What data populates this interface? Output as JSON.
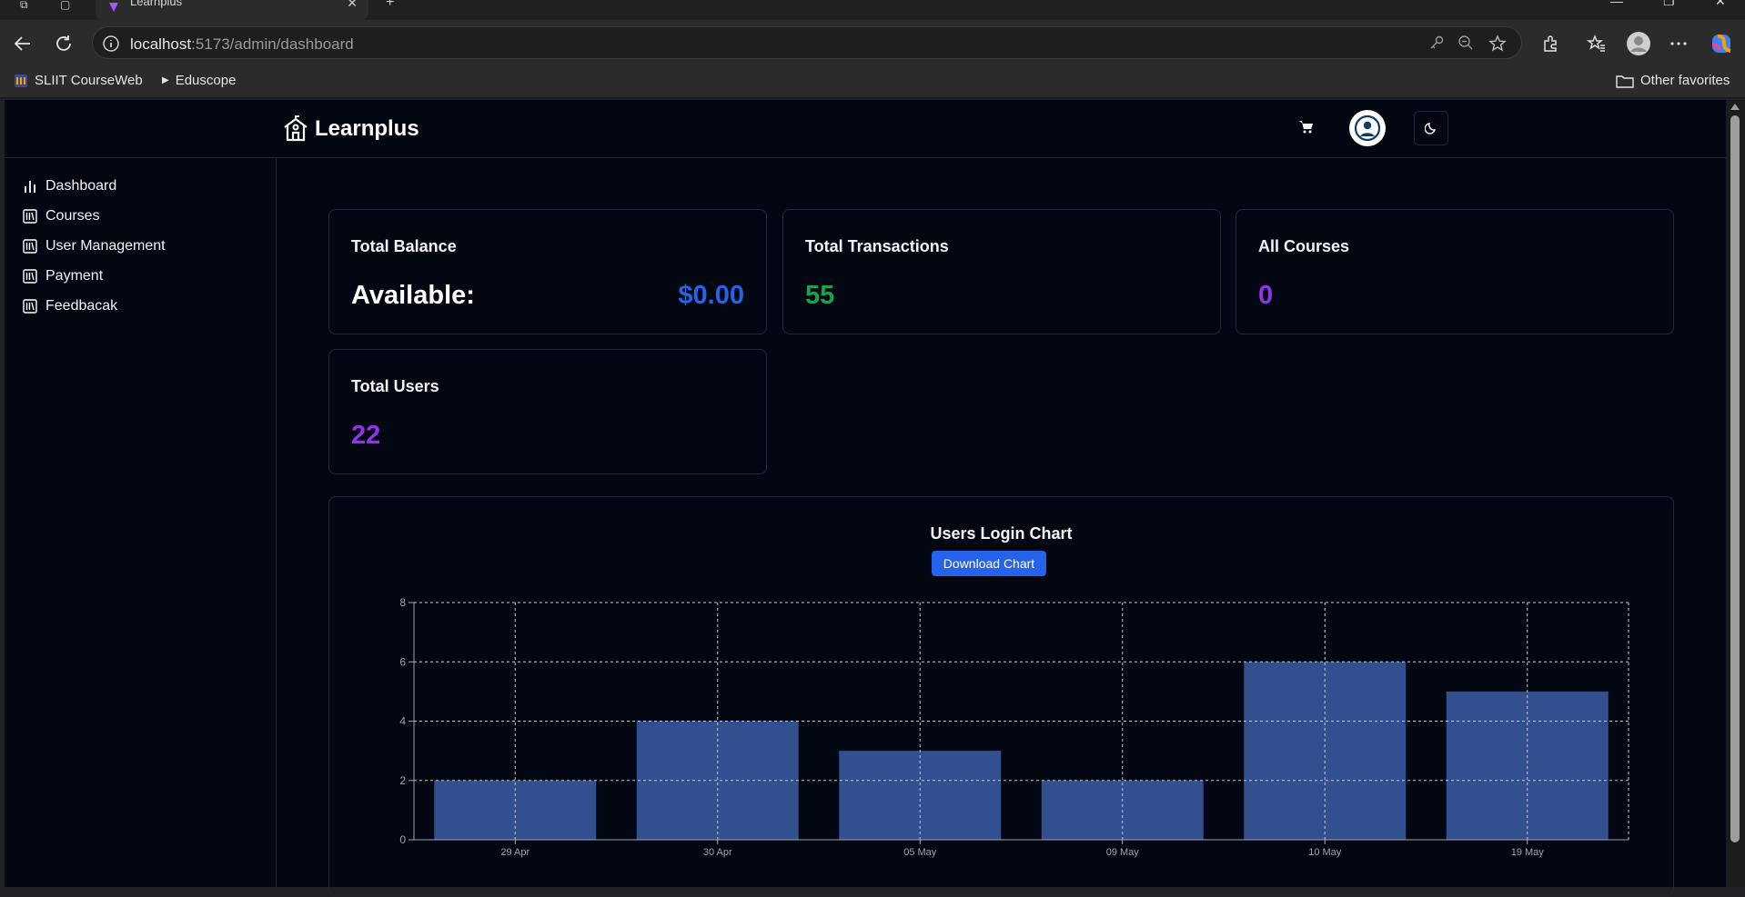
{
  "browser": {
    "tab_title": "Learnplus",
    "url_host": "localhost",
    "url_rest": ":5173/admin/dashboard",
    "bookmarks": [
      "SLIIT CourseWeb",
      "Eduscope"
    ],
    "other_favorites": "Other favorites"
  },
  "app": {
    "logo_text": "Learnplus",
    "sidebar": [
      {
        "label": "Dashboard",
        "icon": "bar-chart-icon"
      },
      {
        "label": "Courses",
        "icon": "library-icon"
      },
      {
        "label": "User Management",
        "icon": "library-icon"
      },
      {
        "label": "Payment",
        "icon": "library-icon"
      },
      {
        "label": "Feedbacak",
        "icon": "library-icon"
      }
    ],
    "cards": {
      "balance": {
        "title": "Total Balance",
        "label": "Available:",
        "value": "$0.00"
      },
      "transactions": {
        "title": "Total Transactions",
        "value": "55"
      },
      "courses": {
        "title": "All Courses",
        "value": "0"
      },
      "users": {
        "title": "Total Users",
        "value": "22"
      }
    },
    "chart_title": "Users Login Chart",
    "download_label": "Download Chart",
    "colors": {
      "accent_blue": "#2563eb",
      "green": "#16a34a",
      "purple": "#9333ea",
      "bar": "#324f90",
      "background": "#030712"
    }
  },
  "chart_data": {
    "type": "bar",
    "title": "Users Login Chart",
    "categories": [
      "29 Apr",
      "30 Apr",
      "05 May",
      "09 May",
      "10 May",
      "19 May"
    ],
    "values": [
      2,
      4,
      3,
      2,
      6,
      5
    ],
    "ylim": [
      0,
      8
    ],
    "yticks": [
      0,
      2,
      4,
      6,
      8
    ],
    "grid": true,
    "xlabel": "",
    "ylabel": ""
  }
}
